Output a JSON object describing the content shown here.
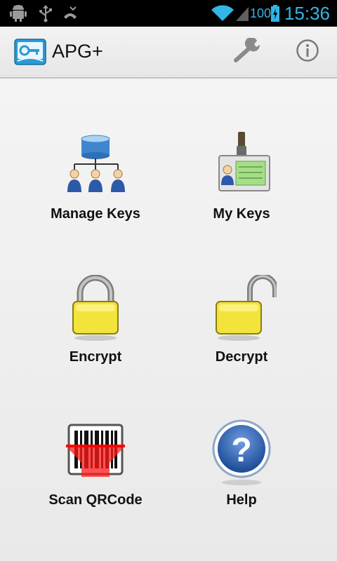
{
  "status_bar": {
    "icons": [
      "android-debug-icon",
      "usb-icon",
      "missed-call-icon",
      "wifi-icon",
      "signal-icon",
      "battery-icon"
    ],
    "battery_level": "100",
    "time": "15:36",
    "accent_color": "#33b5e5"
  },
  "action_bar": {
    "title": "APG+",
    "settings_icon": "wrench-icon",
    "info_icon": "info-icon"
  },
  "grid": {
    "items": [
      {
        "label": "Manage Keys",
        "icon": "manage-keys-icon"
      },
      {
        "label": "My Keys",
        "icon": "my-keys-icon"
      },
      {
        "label": "Encrypt",
        "icon": "lock-closed-icon"
      },
      {
        "label": "Decrypt",
        "icon": "lock-open-icon"
      },
      {
        "label": "Scan QRCode",
        "icon": "barcode-scanner-icon"
      },
      {
        "label": "Help",
        "icon": "help-icon"
      }
    ]
  }
}
